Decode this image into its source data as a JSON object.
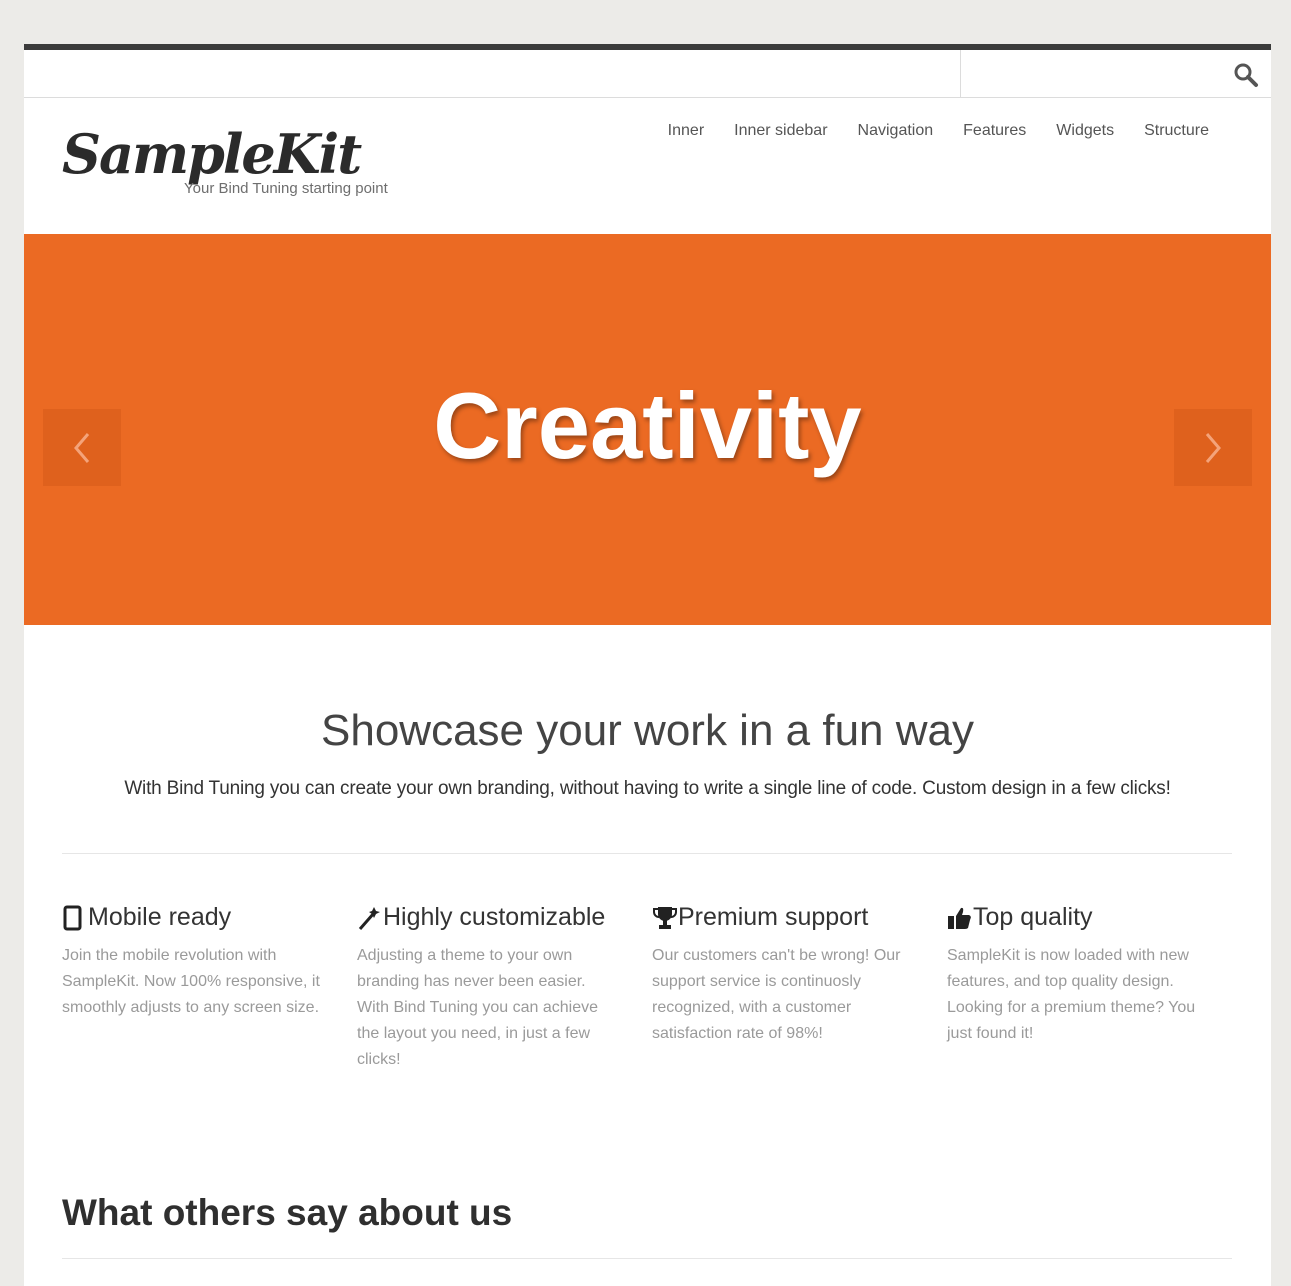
{
  "search": {
    "placeholder": "",
    "value": ""
  },
  "header": {
    "logo_text": "SampleKit",
    "tagline": "Your Bind Tuning starting point"
  },
  "nav": {
    "items": [
      {
        "label": "Inner"
      },
      {
        "label": "Inner sidebar"
      },
      {
        "label": "Navigation"
      },
      {
        "label": "Features"
      },
      {
        "label": "Widgets"
      },
      {
        "label": "Structure"
      }
    ]
  },
  "hero": {
    "title": "Creativity",
    "background_color": "#eb6a23",
    "prev_icon": "chevron-left-icon",
    "next_icon": "chevron-right-icon"
  },
  "intro": {
    "title": "Showcase your work in a fun way",
    "text": "With Bind Tuning you can create your own branding, without having to write a single line of code. Custom design in a few clicks!"
  },
  "features": [
    {
      "icon": "mobile-icon",
      "title": "Mobile ready",
      "text": "Join the mobile revolution with SampleKit. Now 100% responsive, it smoothly adjusts to any screen size."
    },
    {
      "icon": "magic-wand-icon",
      "title": "Highly customizable",
      "text": "Adjusting a theme to your own branding has never been easier. With Bind Tuning you can achieve the layout you need, in just a few clicks!"
    },
    {
      "icon": "trophy-icon",
      "title": "Premium support",
      "text": "Our customers can't be wrong! Our support service is continuosly recognized, with a customer satisfaction rate of 98%!"
    },
    {
      "icon": "thumbs-up-icon",
      "title": "Top quality",
      "text": "SampleKit is now loaded with new features, and top quality design. Looking for a premium theme? You just found it!"
    }
  ],
  "testimonials": {
    "title": "What others say about us"
  }
}
